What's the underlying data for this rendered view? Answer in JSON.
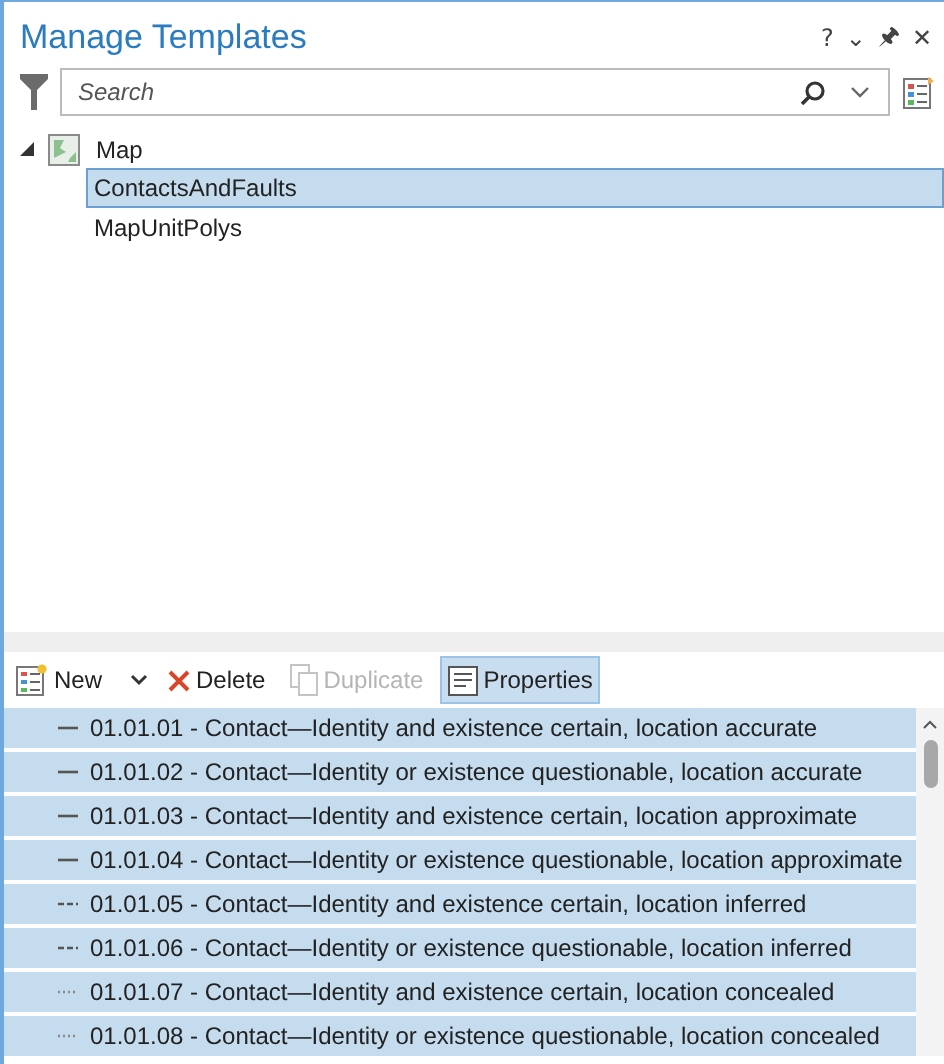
{
  "window": {
    "title": "Manage Templates",
    "controls": [
      "?",
      "⌄",
      "🖈",
      "✕"
    ]
  },
  "search": {
    "placeholder": "Search"
  },
  "tree": [
    {
      "label": "Map",
      "expanded": true,
      "selected": false,
      "children": [
        {
          "label": "ContactsAndFaults",
          "selected": true
        },
        {
          "label": "MapUnitPolys",
          "selected": false
        }
      ]
    }
  ],
  "toolbar": [
    {
      "kind": "new",
      "label": "New",
      "disabled": false,
      "selected": false
    },
    {
      "kind": "delete",
      "label": "Delete",
      "disabled": false,
      "selected": false
    },
    {
      "kind": "duplicate",
      "label": "Duplicate",
      "disabled": true,
      "selected": false
    },
    {
      "kind": "properties",
      "label": "Properties",
      "disabled": false,
      "selected": true
    }
  ],
  "templates": [
    {
      "label": "01.01.01 - Contact—Identity and existence certain, location accurate",
      "kind": "solid",
      "selected": true
    },
    {
      "label": "01.01.02 - Contact—Identity or existence questionable, location accurate",
      "kind": "solid",
      "selected": true
    },
    {
      "label": "01.01.03 - Contact—Identity and existence certain, location approximate",
      "kind": "solid",
      "selected": true
    },
    {
      "label": "01.01.04 - Contact—Identity or existence questionable, location approximate",
      "kind": "solid",
      "selected": true
    },
    {
      "label": "01.01.05 - Contact—Identity and existence certain, location inferred",
      "kind": "dashed",
      "selected": true
    },
    {
      "label": "01.01.06 - Contact—Identity or existence questionable, location inferred",
      "kind": "dashed",
      "selected": true
    },
    {
      "label": "01.01.07 - Contact—Identity and existence certain, location concealed",
      "kind": "dotted",
      "selected": true
    },
    {
      "label": "01.01.08 - Contact—Identity or existence questionable, location concealed",
      "kind": "dotted",
      "selected": true
    }
  ]
}
